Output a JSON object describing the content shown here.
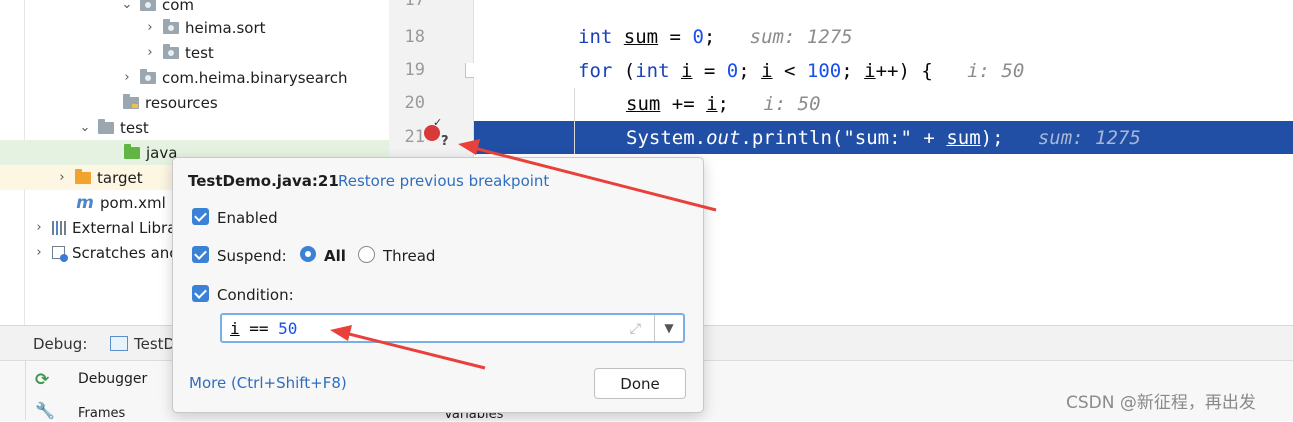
{
  "tree": {
    "items": [
      {
        "label": "com"
      },
      {
        "label": "heima.sort"
      },
      {
        "label": "test"
      },
      {
        "label": "com.heima.binarysearch"
      },
      {
        "label": "resources"
      },
      {
        "label": "test"
      },
      {
        "label": "java"
      },
      {
        "label": "target"
      },
      {
        "label": "pom.xml"
      },
      {
        "label": "External Libra"
      },
      {
        "label": "Scratches anc"
      }
    ]
  },
  "editor": {
    "line_numbers": [
      "17",
      "18",
      "19",
      "20",
      "21"
    ],
    "lines": [
      {
        "kw": "int",
        "var": "sum",
        "rest": " = ",
        "num": "0",
        "end": ";",
        "hint": "sum: 1275"
      },
      {
        "kw": "for",
        "p1": " (",
        "kw2": "int",
        "v1": "i",
        "p2": " = ",
        "n1": "0",
        "p3": "; ",
        "v2": "i",
        "p4": " < ",
        "n2": "100",
        "p5": "; ",
        "v3": "i",
        "p6": "++) {",
        "hint": "i: 50"
      },
      {
        "var": "sum",
        "rest": " += ",
        "var2": "i",
        "end": ";",
        "hint": "i: 50"
      },
      {
        "pre": "System.",
        "field": "out",
        "mid": ".println(\"sum:\" + ",
        "var": "sum",
        "end": ");",
        "hint": "sum: 1275"
      }
    ]
  },
  "debug": {
    "label": "Debug:",
    "tab": "TestD",
    "debugger_tab": "Debugger",
    "frames": "Frames",
    "variables": "Variables"
  },
  "popup": {
    "location": "TestDemo.java:21",
    "restore_link": "Restore previous breakpoint",
    "enabled_label": "Enabled",
    "suspend_label": "Suspend:",
    "all_label": "All",
    "thread_label": "Thread",
    "condition_label": "Condition:",
    "condition_var": "i",
    "condition_op": " == ",
    "condition_num": "50",
    "more_link": "More (Ctrl+Shift+F8)",
    "done_button": "Done"
  },
  "watermark": "CSDN @新征程，再出发",
  "colors": {
    "highlight": "#214fa6",
    "accent": "#3b82d6",
    "arrow": "#e8403a"
  }
}
